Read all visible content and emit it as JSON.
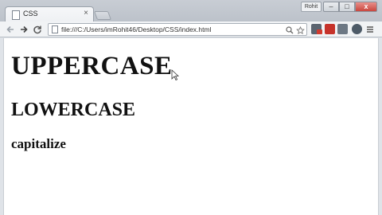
{
  "browser": {
    "tab": {
      "title": "CSS",
      "close_glyph": "×"
    },
    "user_label": "Rohit",
    "window_controls": {
      "minimize": "–",
      "maximize": "□",
      "close": "x"
    },
    "toolbar": {
      "back_icon": "back-arrow-icon",
      "forward_icon": "forward-arrow-icon",
      "reload_icon": "reload-icon",
      "url": "file:///C:/Users/imRohit46/Desktop/CSS/index.html",
      "extensions": [
        "ext-icon",
        "ext-icon",
        "ext-icon",
        "ext-icon"
      ]
    }
  },
  "page": {
    "heading_upper": "UPPERCASE",
    "heading_lower": "LOWERCASE",
    "heading_capitalize": "capitalize"
  },
  "colors": {
    "tab_bar": "#c8cdd4",
    "toolbar": "#f1f3f5",
    "close_button": "#c9463e",
    "text": "#111111"
  }
}
